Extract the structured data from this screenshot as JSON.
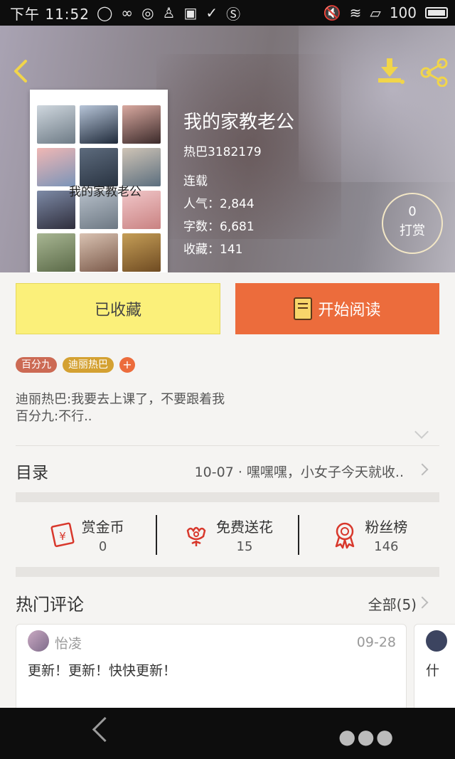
{
  "status_bar": {
    "time": "下午 11:52",
    "battery": "100",
    "icons": [
      "message-icon",
      "loop-icon",
      "qq-browser-icon",
      "qq-icon",
      "gallery-icon",
      "check-icon",
      "s-app-icon"
    ]
  },
  "header": {
    "back_icon": "chevron-left-icon",
    "download_icon": "download-icon",
    "share_icon": "share-icon"
  },
  "book": {
    "cover_title": "我的家教老公",
    "title": "我的家教老公",
    "author": "热巴3182179",
    "status": "连载",
    "stats": [
      {
        "label": "人气",
        "sep": "：",
        "value": "2,844"
      },
      {
        "label": "字数",
        "sep": "：",
        "value": "6,681"
      },
      {
        "label": "收藏",
        "sep": "：",
        "value": "141"
      }
    ]
  },
  "reward": {
    "count": "0",
    "label": "打赏"
  },
  "actions": {
    "favorite_label": "已收藏",
    "read_label": "开始阅读"
  },
  "tags": [
    "百分九",
    "迪丽热巴"
  ],
  "tag_add": "+",
  "description": [
    "迪丽热巴:我要去上课了，不要跟着我",
    "百分九:不行.."
  ],
  "toc": {
    "label": "目录",
    "latest": "10-07 · 嘿嘿嘿，小女子今天就收.."
  },
  "stats_row": [
    {
      "icon": "red-envelope-icon",
      "label": "赏金币",
      "value": "0"
    },
    {
      "icon": "flower-icon",
      "label": "免费送花",
      "value": "15"
    },
    {
      "icon": "medal-icon",
      "label": "粉丝榜",
      "value": "146"
    }
  ],
  "comments": {
    "title": "热门评论",
    "all_label": "全部(5)",
    "items": [
      {
        "user": "怡凌",
        "date": "09-28",
        "text": "更新！更新！快快更新！"
      },
      {
        "user": "",
        "date": "",
        "text": "什"
      }
    ]
  },
  "colors": {
    "accent_orange": "#ec6c3c",
    "favorite_yellow": "#fbf07a",
    "icon_yellow": "#f1d54a",
    "icon_red": "#d8382c"
  }
}
